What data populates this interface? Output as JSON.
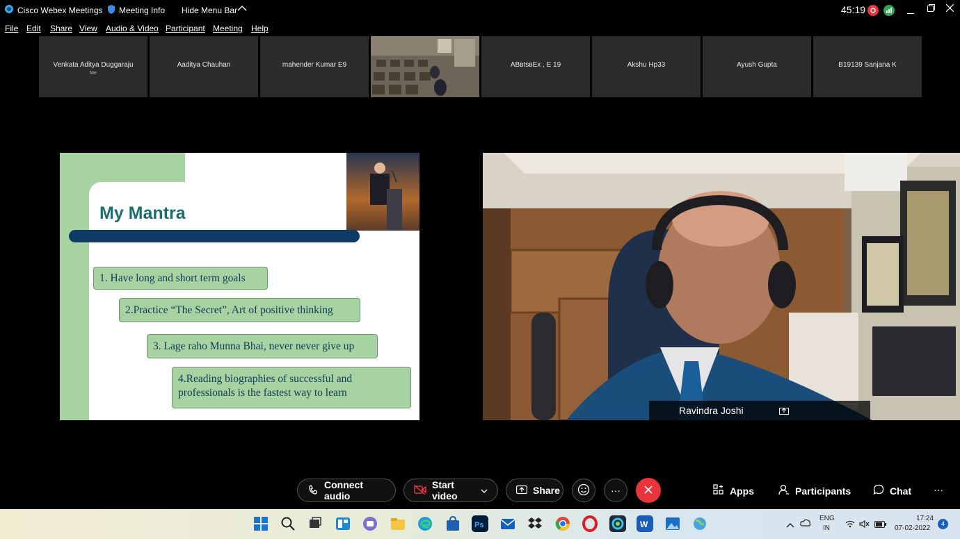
{
  "window": {
    "app_title": "Cisco Webex Meetings",
    "meeting_info": "Meeting Info",
    "hide_menu": "Hide Menu Bar",
    "timer": "45:19"
  },
  "menu": [
    "File",
    "Edit",
    "Share",
    "View",
    "Audio & Video",
    "Participant",
    "Meeting",
    "Help"
  ],
  "participants": [
    {
      "name": "Venkata Aditya Duggaraju",
      "sub": "Me"
    },
    {
      "name": "Aaditya Chauhan"
    },
    {
      "name": "mahender Kumar E9"
    },
    {
      "name": ""
    },
    {
      "name": "ABвIsвEx , E 19"
    },
    {
      "name": "Akshu Hp33"
    },
    {
      "name": "Ayush Gupta"
    },
    {
      "name": "B19139 Sanjana K"
    }
  ],
  "slide": {
    "title": "My Mantra",
    "points": [
      "1. Have long and short term goals",
      "2.Practice “The Secret”, Art of positive thinking",
      "3. Lage raho Munna Bhai, never never give up",
      "4.Reading biographies of successful and professionals is the fastest way to learn"
    ]
  },
  "speaker": {
    "name": "Ravindra Joshi"
  },
  "controls": {
    "connect_audio": "Connect audio",
    "start_video": "Start video",
    "share": "Share",
    "apps": "Apps",
    "participants": "Participants",
    "chat": "Chat",
    "more": "···"
  },
  "taskbar": {
    "lang_top": "ENG",
    "lang_bottom": "IN",
    "time": "17:24",
    "date": "07-02-2022",
    "notif_count": "4"
  },
  "colors": {
    "accent_green": "#a7d3a2",
    "title_teal": "#1a6e6e",
    "end_red": "#e8343a",
    "navy": "#0d3b66"
  }
}
